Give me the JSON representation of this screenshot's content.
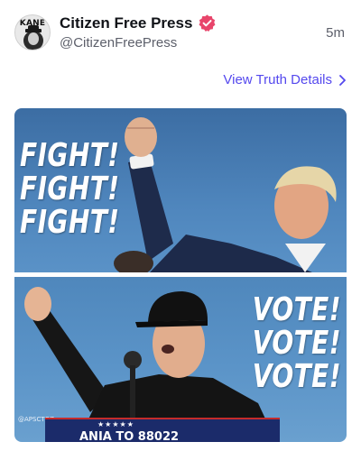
{
  "post": {
    "display_name": "Citizen Free Press",
    "handle": "@CitizenFreePress",
    "timestamp": "5m",
    "verified": true,
    "avatar_label": "KANE",
    "details_link": "View Truth Details",
    "details_icon": "chevron-right-icon"
  },
  "media": {
    "top_panel": {
      "lines": [
        "FIGHT!",
        "FIGHT!",
        "FIGHT!"
      ]
    },
    "bottom_panel": {
      "lines": [
        "VOTE!",
        "VOTE!",
        "VOTE!"
      ],
      "watermark": "@APSCTOZ",
      "banner_stars": "★★★★★",
      "banner_text": "ANIA TO 88022"
    }
  },
  "colors": {
    "accent": "#5448ee",
    "verified_badge": "#e8456b",
    "name_text": "#111318",
    "secondary_text": "#5c5f6a",
    "sky_blue": "#4f86bd"
  }
}
